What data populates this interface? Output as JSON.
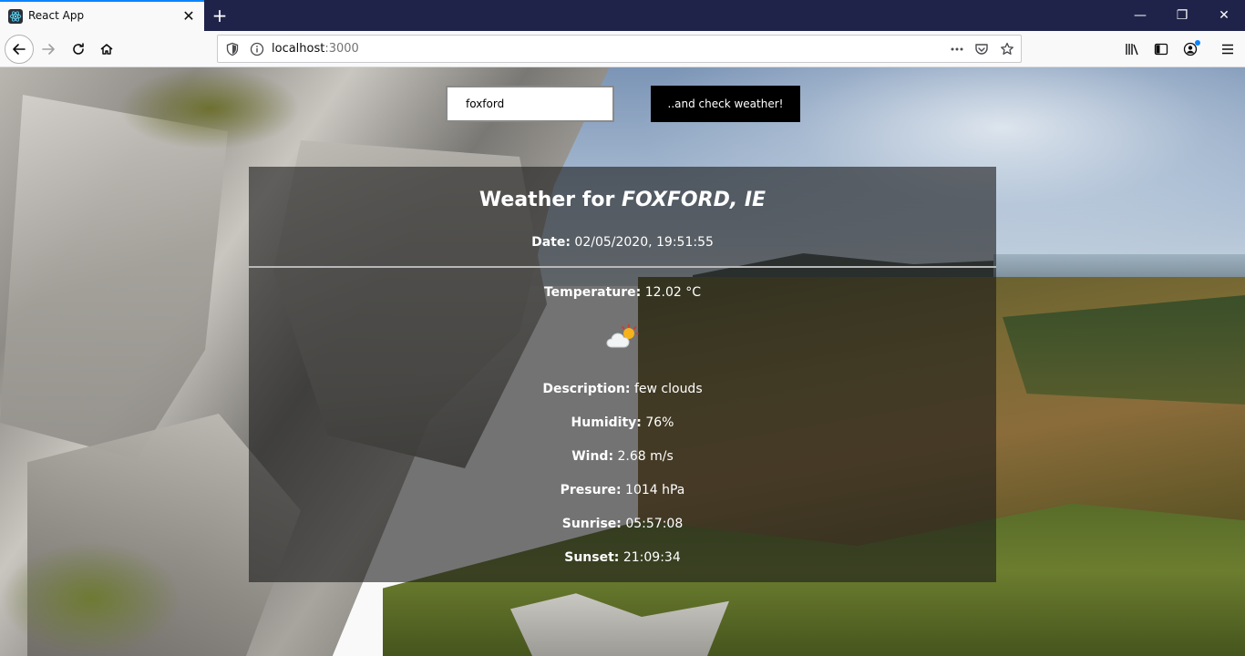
{
  "browser": {
    "tab_title": "React App",
    "tab_close_glyph": "✕",
    "new_tab_glyph": "+",
    "window_controls": {
      "minimize": "—",
      "restore": "❐",
      "close": "✕"
    },
    "url_host": "localhost",
    "url_port": ":3000",
    "icons": [
      "back-icon",
      "forward-icon",
      "reload-icon",
      "home-icon",
      "shield-icon",
      "info-icon",
      "more-icon",
      "pocket-icon",
      "star-icon",
      "library-icon",
      "sidebar-icon",
      "account-icon",
      "menu-icon"
    ]
  },
  "search": {
    "value": "foxford",
    "button_label": "..and check weather!"
  },
  "weather": {
    "title_prefix": "Weather for",
    "location": "FOXFORD, IE",
    "date_label": "Date:",
    "date_value": "02/05/2020, 19:51:55",
    "temperature_label": "Temperature:",
    "temperature_value": "12.02 °C",
    "icon": "few-clouds-icon",
    "description_label": "Description:",
    "description_value": "few clouds",
    "humidity_label": "Humidity:",
    "humidity_value": "76%",
    "wind_label": "Wind:",
    "wind_value": "2.68 m/s",
    "pressure_label": "Presure:",
    "pressure_value": "1014 hPa",
    "sunrise_label": "Sunrise:",
    "sunrise_value": "05:57:08",
    "sunset_label": "Sunset:",
    "sunset_value": "21:09:34"
  },
  "colors": {
    "titlebar": "#1f2349",
    "tab_accent": "#0a84ff",
    "card_bg": "rgba(25,25,25,0.6)",
    "button_bg": "#000000"
  }
}
